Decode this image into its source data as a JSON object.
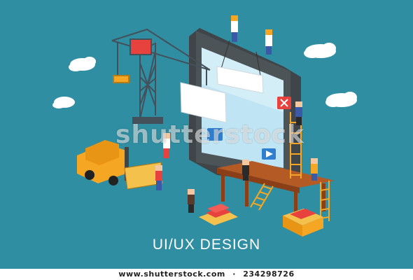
{
  "caption": "UI/UX DESIGN",
  "watermark": "shutterstock",
  "credit_site": "www.shutterstock.com",
  "credit_sep": "·",
  "credit_id": "234298726",
  "colors": {
    "background": "#2f8ea2",
    "tablet_frame": "#4d5457",
    "tablet_screen": "#bfe4f3",
    "crane": "#44505a",
    "forklift": "#f5a623",
    "accent_red": "#e8423f",
    "cloud": "#ffffff"
  },
  "icons": [
    "crane-icon",
    "forklift-icon",
    "tablet-icon",
    "ladder-icon",
    "desk-icon",
    "cloud-icon",
    "worker-icon",
    "crate-icon"
  ]
}
